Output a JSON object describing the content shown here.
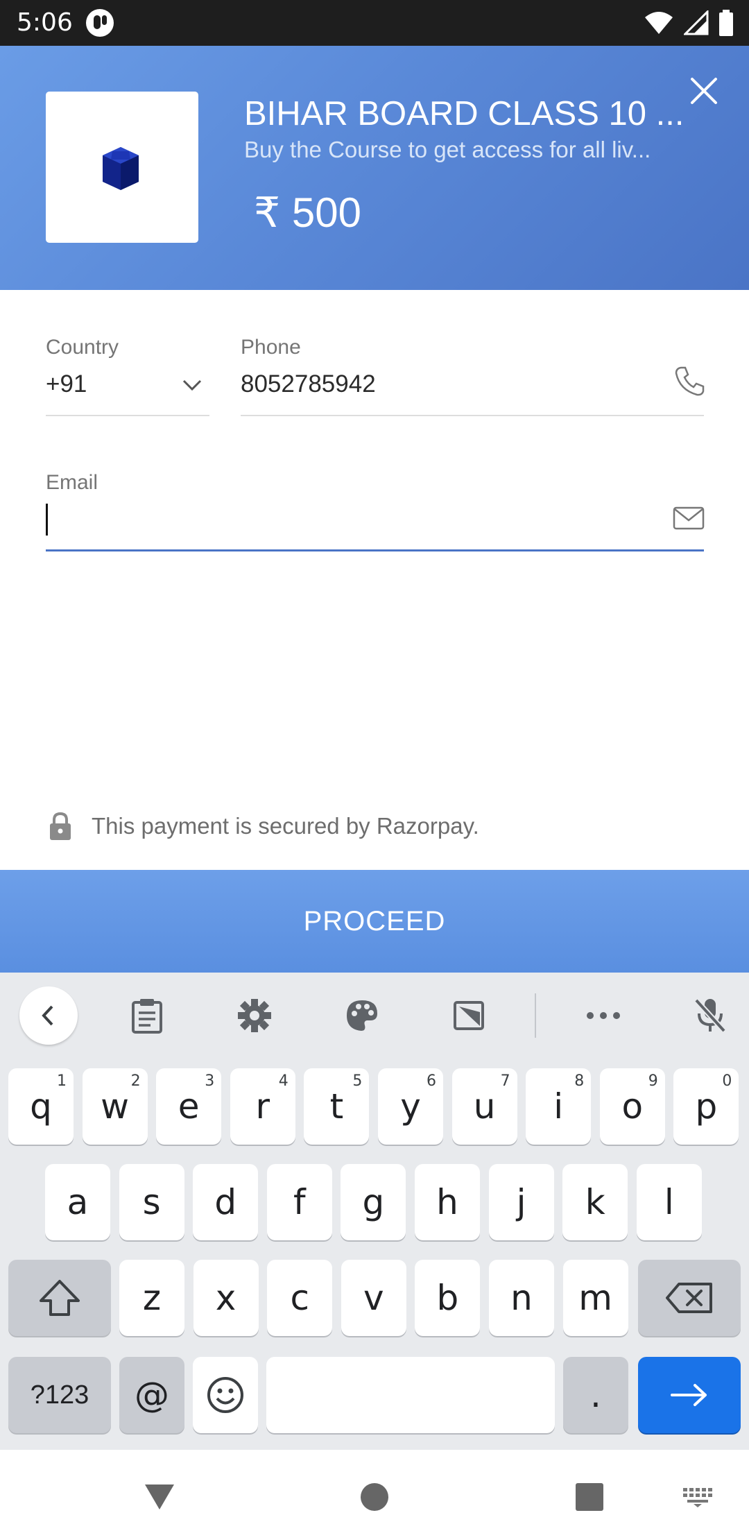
{
  "status_bar": {
    "time": "5:06"
  },
  "header": {
    "title": "BIHAR BOARD CLASS 10 ...",
    "subtitle": "Buy the Course to get access for all liv...",
    "price": "₹ 500"
  },
  "form": {
    "country_label": "Country",
    "country_value": "+91",
    "phone_label": "Phone",
    "phone_value": "8052785942",
    "email_label": "Email",
    "email_value": ""
  },
  "secure_text": "This payment is secured by Razorpay.",
  "proceed_label": "PROCEED",
  "keyboard": {
    "row1": [
      {
        "k": "q",
        "h": "1"
      },
      {
        "k": "w",
        "h": "2"
      },
      {
        "k": "e",
        "h": "3"
      },
      {
        "k": "r",
        "h": "4"
      },
      {
        "k": "t",
        "h": "5"
      },
      {
        "k": "y",
        "h": "6"
      },
      {
        "k": "u",
        "h": "7"
      },
      {
        "k": "i",
        "h": "8"
      },
      {
        "k": "o",
        "h": "9"
      },
      {
        "k": "p",
        "h": "0"
      }
    ],
    "row2": [
      "a",
      "s",
      "d",
      "f",
      "g",
      "h",
      "j",
      "k",
      "l"
    ],
    "row3": [
      "z",
      "x",
      "c",
      "v",
      "b",
      "n",
      "m"
    ],
    "symbols_label": "?123",
    "at_label": "@",
    "period_label": "."
  },
  "colors": {
    "header": "#5a89d8",
    "accent": "#1a73e8",
    "proceed": "#5e93e3"
  },
  "icons": [
    "close-icon",
    "cube-logo-icon",
    "chevron-down-icon",
    "phone-icon",
    "mail-icon",
    "lock-icon",
    "back-chevron-icon",
    "clipboard-icon",
    "settings-gear-icon",
    "palette-icon",
    "crop-icon",
    "more-dots-icon",
    "mic-off-icon",
    "shift-icon",
    "backspace-icon",
    "emoji-icon",
    "enter-arrow-icon",
    "nav-back-icon",
    "nav-home-icon",
    "nav-recents-icon",
    "keyboard-switch-icon"
  ]
}
